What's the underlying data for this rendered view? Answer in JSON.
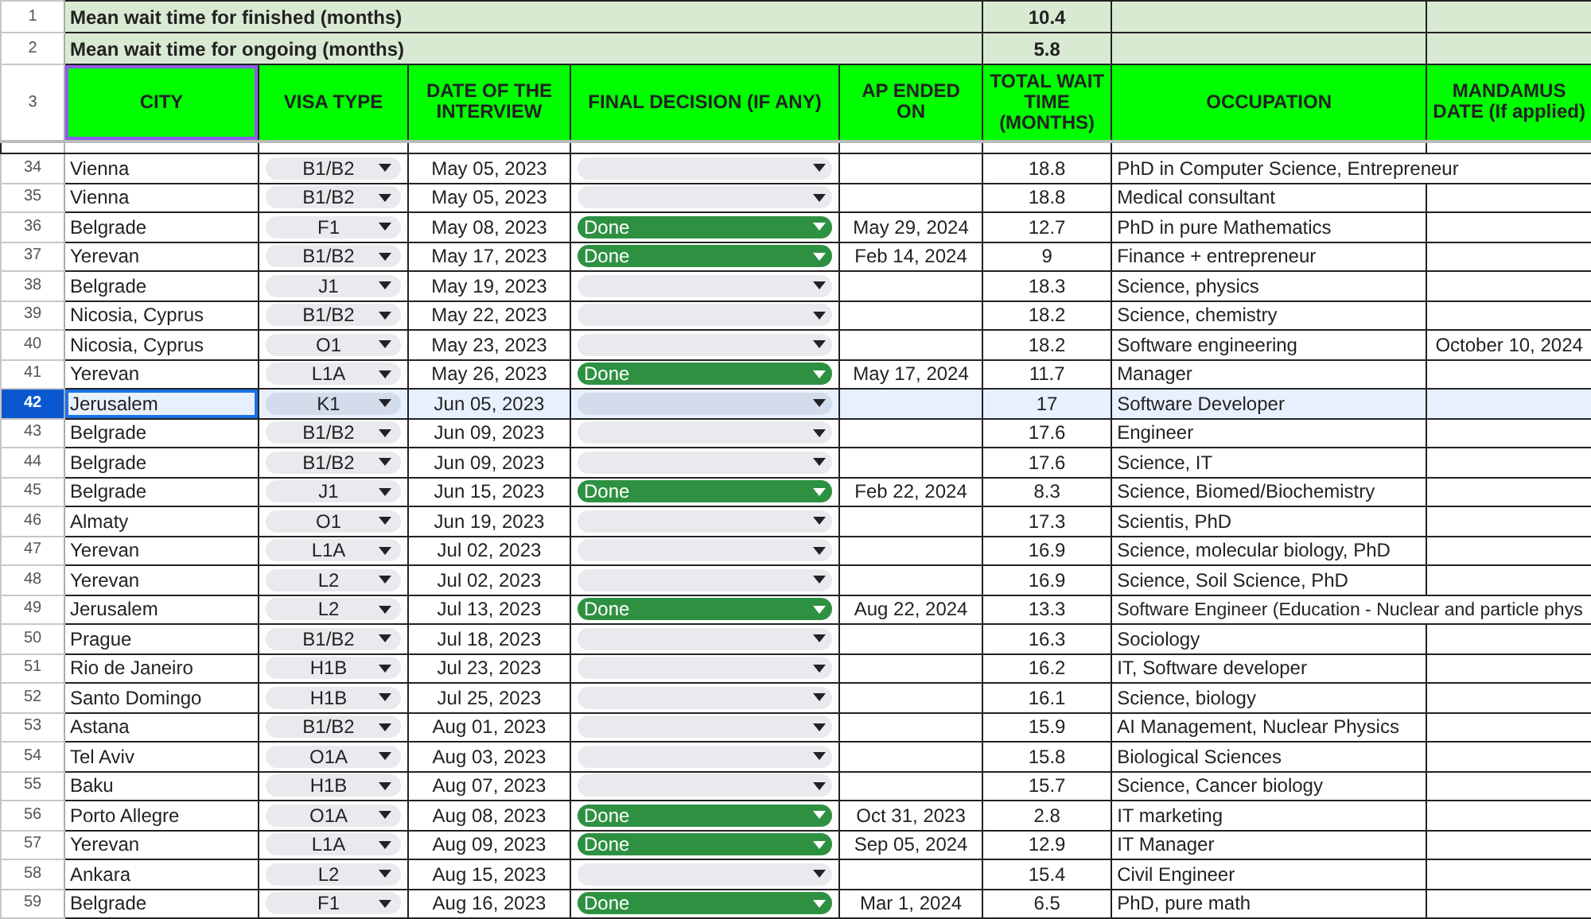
{
  "summary": [
    {
      "row_number": "1",
      "label": "Mean wait time for finished (months)",
      "value": "10.4"
    },
    {
      "row_number": "2",
      "label": "Mean wait time for ongoing (months)",
      "value": "5.8"
    }
  ],
  "header_row_number": "3",
  "columns": [
    {
      "label": "CITY",
      "outlined": true
    },
    {
      "label": "VISA TYPE",
      "outlined": false
    },
    {
      "label": "DATE OF THE INTERVIEW",
      "outlined": false
    },
    {
      "label": "FINAL DECISION (IF ANY)",
      "outlined": false
    },
    {
      "label": "AP ENDED ON",
      "outlined": false
    },
    {
      "label": "TOTAL WAIT TIME (MONTHS)",
      "outlined": false
    },
    {
      "label": "OCCUPATION",
      "outlined": false
    },
    {
      "label": "MANDAMUS DATE (If applied)",
      "outlined": false
    }
  ],
  "rows": [
    {
      "number": "34",
      "city": "Vienna",
      "visa_type": "B1/B2",
      "interview_date": "May 05, 2023",
      "decision": null,
      "ap_ended_on": "",
      "total_wait": "18.8",
      "occupation": "PhD in Computer Science, Entrepreneur",
      "mandamus_date": "",
      "selected": false
    },
    {
      "number": "35",
      "city": "Vienna",
      "visa_type": "B1/B2",
      "interview_date": "May 05, 2023",
      "decision": null,
      "ap_ended_on": "",
      "total_wait": "18.8",
      "occupation": "Medical consultant",
      "mandamus_date": "",
      "selected": false
    },
    {
      "number": "36",
      "city": "Belgrade",
      "visa_type": "F1",
      "interview_date": "May 08, 2023",
      "decision": "Done",
      "ap_ended_on": "May 29, 2024",
      "total_wait": "12.7",
      "occupation": "PhD in pure Mathematics",
      "mandamus_date": "",
      "selected": false
    },
    {
      "number": "37",
      "city": "Yerevan",
      "visa_type": "B1/B2",
      "interview_date": "May 17, 2023",
      "decision": "Done",
      "ap_ended_on": "Feb 14, 2024",
      "total_wait": "9",
      "occupation": "Finance + entrepreneur",
      "mandamus_date": "",
      "selected": false
    },
    {
      "number": "38",
      "city": "Belgrade",
      "visa_type": "J1",
      "interview_date": "May 19, 2023",
      "decision": null,
      "ap_ended_on": "",
      "total_wait": "18.3",
      "occupation": "Science, physics",
      "mandamus_date": "",
      "selected": false
    },
    {
      "number": "39",
      "city": "Nicosia, Cyprus",
      "visa_type": "B1/B2",
      "interview_date": "May 22, 2023",
      "decision": null,
      "ap_ended_on": "",
      "total_wait": "18.2",
      "occupation": "Science, chemistry",
      "mandamus_date": "",
      "selected": false
    },
    {
      "number": "40",
      "city": "Nicosia, Cyprus",
      "visa_type": "O1",
      "interview_date": "May 23, 2023",
      "decision": null,
      "ap_ended_on": "",
      "total_wait": "18.2",
      "occupation": "Software engineering",
      "mandamus_date": "October 10, 2024",
      "selected": false
    },
    {
      "number": "41",
      "city": "Yerevan",
      "visa_type": "L1A",
      "interview_date": "May 26, 2023",
      "decision": "Done",
      "ap_ended_on": "May 17, 2024",
      "total_wait": "11.7",
      "occupation": "Manager",
      "mandamus_date": "",
      "selected": false
    },
    {
      "number": "42",
      "city": "Jerusalem",
      "visa_type": "K1",
      "interview_date": "Jun 05, 2023",
      "decision": null,
      "ap_ended_on": "",
      "total_wait": "17",
      "occupation": "Software Developer",
      "mandamus_date": "",
      "selected": true
    },
    {
      "number": "43",
      "city": "Belgrade",
      "visa_type": "B1/B2",
      "interview_date": "Jun 09, 2023",
      "decision": null,
      "ap_ended_on": "",
      "total_wait": "17.6",
      "occupation": "Engineer",
      "mandamus_date": "",
      "selected": false
    },
    {
      "number": "44",
      "city": "Belgrade",
      "visa_type": "B1/B2",
      "interview_date": "Jun 09, 2023",
      "decision": null,
      "ap_ended_on": "",
      "total_wait": "17.6",
      "occupation": "Science, IT",
      "mandamus_date": "",
      "selected": false
    },
    {
      "number": "45",
      "city": "Belgrade",
      "visa_type": "J1",
      "interview_date": "Jun 15, 2023",
      "decision": "Done",
      "ap_ended_on": "Feb 22, 2024",
      "total_wait": "8.3",
      "occupation": "Science, Biomed/Biochemistry",
      "mandamus_date": "",
      "selected": false
    },
    {
      "number": "46",
      "city": "Almaty",
      "visa_type": "O1",
      "interview_date": "Jun 19, 2023",
      "decision": null,
      "ap_ended_on": "",
      "total_wait": "17.3",
      "occupation": "Scientis, PhD",
      "mandamus_date": "",
      "selected": false
    },
    {
      "number": "47",
      "city": "Yerevan",
      "visa_type": "L1A",
      "interview_date": "Jul 02, 2023",
      "decision": null,
      "ap_ended_on": "",
      "total_wait": "16.9",
      "occupation": "Science, molecular biology, PhD",
      "mandamus_date": "",
      "selected": false
    },
    {
      "number": "48",
      "city": "Yerevan",
      "visa_type": "L2",
      "interview_date": "Jul 02, 2023",
      "decision": null,
      "ap_ended_on": "",
      "total_wait": "16.9",
      "occupation": "Science, Soil Science, PhD",
      "mandamus_date": "",
      "selected": false
    },
    {
      "number": "49",
      "city": "Jerusalem",
      "visa_type": "L2",
      "interview_date": "Jul 13, 2023",
      "decision": "Done",
      "ap_ended_on": "Aug 22, 2024",
      "total_wait": "13.3",
      "occupation": "Software Engineer (Education - Nuclear and particle phys",
      "mandamus_date": "",
      "selected": false
    },
    {
      "number": "50",
      "city": "Prague",
      "visa_type": "B1/B2",
      "interview_date": "Jul 18, 2023",
      "decision": null,
      "ap_ended_on": "",
      "total_wait": "16.3",
      "occupation": "Sociology",
      "mandamus_date": "",
      "selected": false
    },
    {
      "number": "51",
      "city": "Rio de Janeiro",
      "visa_type": "H1B",
      "interview_date": "Jul 23, 2023",
      "decision": null,
      "ap_ended_on": "",
      "total_wait": "16.2",
      "occupation": "IT, Software developer",
      "mandamus_date": "",
      "selected": false
    },
    {
      "number": "52",
      "city": "Santo Domingo",
      "visa_type": "H1B",
      "interview_date": "Jul 25, 2023",
      "decision": null,
      "ap_ended_on": "",
      "total_wait": "16.1",
      "occupation": "Science, biology",
      "mandamus_date": "",
      "selected": false
    },
    {
      "number": "53",
      "city": "Astana",
      "visa_type": "B1/B2",
      "interview_date": "Aug 01, 2023",
      "decision": null,
      "ap_ended_on": "",
      "total_wait": "15.9",
      "occupation": "AI Management, Nuclear Physics",
      "mandamus_date": "",
      "selected": false
    },
    {
      "number": "54",
      "city": "Tel Aviv",
      "visa_type": "O1A",
      "interview_date": "Aug 03, 2023",
      "decision": null,
      "ap_ended_on": "",
      "total_wait": "15.8",
      "occupation": "Biological Sciences",
      "mandamus_date": "",
      "selected": false
    },
    {
      "number": "55",
      "city": "Baku",
      "visa_type": "H1B",
      "interview_date": "Aug 07, 2023",
      "decision": null,
      "ap_ended_on": "",
      "total_wait": "15.7",
      "occupation": "Science, Cancer biology",
      "mandamus_date": "",
      "selected": false
    },
    {
      "number": "56",
      "city": "Porto Allegre",
      "visa_type": "O1A",
      "interview_date": "Aug 08, 2023",
      "decision": "Done",
      "ap_ended_on": "Oct 31, 2023",
      "total_wait": "2.8",
      "occupation": "IT marketing",
      "mandamus_date": "",
      "selected": false
    },
    {
      "number": "57",
      "city": "Yerevan",
      "visa_type": "L1A",
      "interview_date": "Aug 09, 2023",
      "decision": "Done",
      "ap_ended_on": "Sep 05, 2024",
      "total_wait": "12.9",
      "occupation": "IT Manager",
      "mandamus_date": "",
      "selected": false
    },
    {
      "number": "58",
      "city": "Ankara",
      "visa_type": "L2",
      "interview_date": "Aug 15, 2023",
      "decision": null,
      "ap_ended_on": "",
      "total_wait": "15.4",
      "occupation": "Civil Engineer",
      "mandamus_date": "",
      "selected": false
    },
    {
      "number": "59",
      "city": "Belgrade",
      "visa_type": "F1",
      "interview_date": "Aug 16, 2023",
      "decision": "Done",
      "ap_ended_on": "Mar 1, 2024",
      "total_wait": "6.5",
      "occupation": "PhD, pure math",
      "mandamus_date": "",
      "selected": false
    }
  ]
}
